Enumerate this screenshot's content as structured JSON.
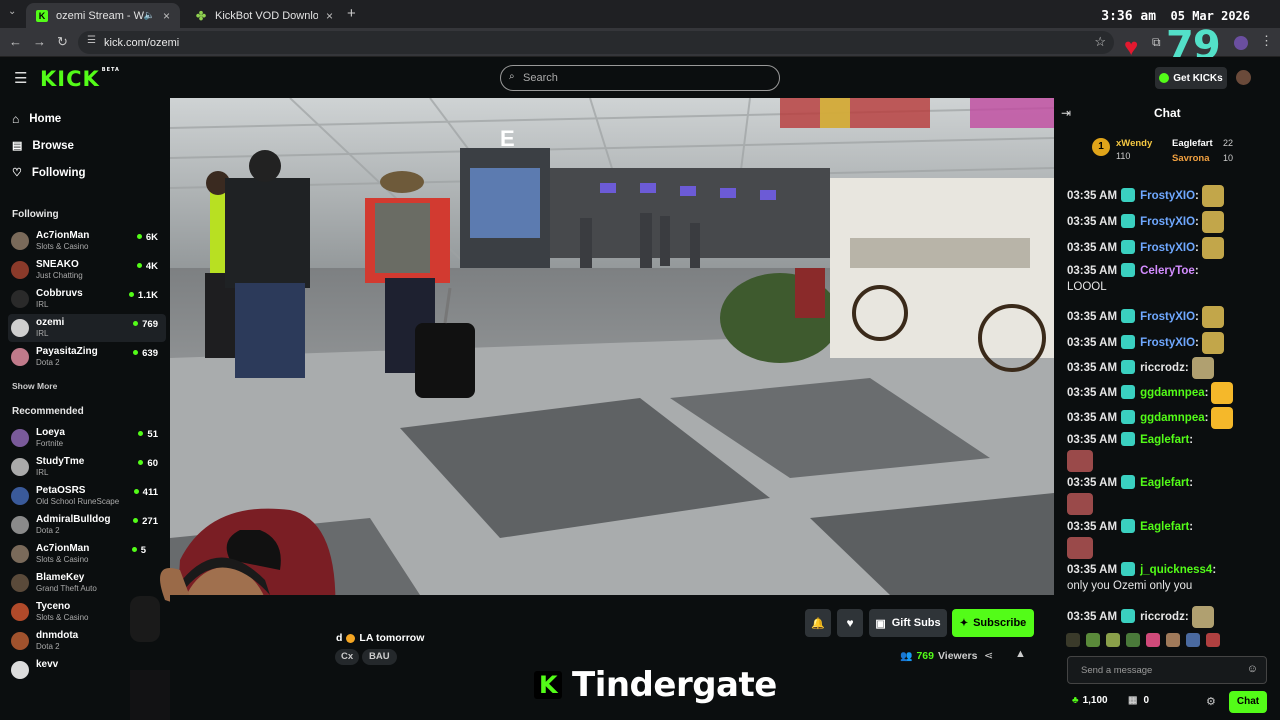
{
  "browser": {
    "tabs": [
      {
        "title": "ozemi Stream - Watch Live",
        "active": true
      },
      {
        "title": "KickBot VOD Downloader",
        "active": false
      }
    ],
    "url": "kick.com/ozemi",
    "clock_time": "3:36 am",
    "clock_date": "05 Mar 2026",
    "overlay_count": "79"
  },
  "header": {
    "logo": "KICK",
    "logo_badge": "BETA",
    "search_placeholder": "Search",
    "get_kicks": "Get KICKs"
  },
  "sidebar": {
    "nav": [
      {
        "label": "Home",
        "icon": "home-icon"
      },
      {
        "label": "Browse",
        "icon": "browse-icon"
      },
      {
        "label": "Following",
        "icon": "heart-icon"
      }
    ],
    "following_title": "Following",
    "following": [
      {
        "name": "Ac7ionMan",
        "category": "Slots & Casino",
        "viewers": "6K"
      },
      {
        "name": "SNEAKO",
        "category": "Just Chatting",
        "viewers": "4K"
      },
      {
        "name": "Cobbruvs",
        "category": "IRL",
        "viewers": "1.1K"
      },
      {
        "name": "ozemi",
        "category": "IRL",
        "viewers": "769"
      },
      {
        "name": "PayasitaZing",
        "category": "Dota 2",
        "viewers": "639"
      }
    ],
    "show_more": "Show More",
    "recommended_title": "Recommended",
    "recommended": [
      {
        "name": "Loeya",
        "category": "Fortnite",
        "viewers": "51"
      },
      {
        "name": "StudyTme",
        "category": "IRL",
        "viewers": "60"
      },
      {
        "name": "PetaOSRS",
        "category": "Old School RuneScape",
        "viewers": "411"
      },
      {
        "name": "AdmiralBulldog",
        "category": "Dota 2",
        "viewers": "271"
      },
      {
        "name": "Ac7ionMan",
        "category": "Slots & Casino",
        "viewers": "5"
      },
      {
        "name": "BlameKey",
        "category": "Grand Theft Auto",
        "viewers": ""
      },
      {
        "name": "Tyceno",
        "category": "Slots & Casino",
        "viewers": ""
      },
      {
        "name": "dnmdota",
        "category": "Dota 2",
        "viewers": ""
      },
      {
        "name": "kevv",
        "category": "",
        "viewers": ""
      }
    ]
  },
  "stream": {
    "title_fragment": "LA tomorrow",
    "title_prefix": "d",
    "tags": [
      "Cx",
      "BAU"
    ],
    "gift_subs": "Gift Subs",
    "subscribe": "Subscribe",
    "viewers": "769",
    "viewers_label": "Viewers",
    "overlay_text": "Tindergate"
  },
  "chat": {
    "title": "Chat",
    "leaderboard": [
      {
        "rank": "1",
        "name": "xWendy",
        "value": "110"
      },
      {
        "name": "Eaglefart",
        "value": "22"
      },
      {
        "name": "Savrona",
        "value": "10"
      }
    ],
    "messages": [
      {
        "time": "03:35 AM",
        "user": "FrostyXIO",
        "color": "#6fa8ff",
        "text": ""
      },
      {
        "time": "03:35 AM",
        "user": "FrostyXIO",
        "color": "#6fa8ff",
        "text": ""
      },
      {
        "time": "03:35 AM",
        "user": "FrostyXIO",
        "color": "#6fa8ff",
        "text": ""
      },
      {
        "time": "03:35 AM",
        "user": "CeleryToe",
        "color": "#d38cff",
        "text": "LOOOL"
      },
      {
        "time": "03:35 AM",
        "user": "FrostyXIO",
        "color": "#6fa8ff",
        "text": ""
      },
      {
        "time": "03:35 AM",
        "user": "FrostyXIO",
        "color": "#6fa8ff",
        "text": ""
      },
      {
        "time": "03:35 AM",
        "user": "riccrodz",
        "color": "#e6e6e6",
        "text": ""
      },
      {
        "time": "03:35 AM",
        "user": "ggdamnpea",
        "color": "#53fc18",
        "text": ""
      },
      {
        "time": "03:35 AM",
        "user": "ggdamnpea",
        "color": "#53fc18",
        "text": ""
      },
      {
        "time": "03:35 AM",
        "user": "Eaglefart",
        "color": "#53fc18",
        "text": ""
      },
      {
        "time": "03:35 AM",
        "user": "Eaglefart",
        "color": "#53fc18",
        "text": ""
      },
      {
        "time": "03:35 AM",
        "user": "Eaglefart",
        "color": "#53fc18",
        "text": ""
      },
      {
        "time": "03:35 AM",
        "user": "j_quickness4",
        "color": "#53fc18",
        "text": "only you Ozemi only you"
      },
      {
        "time": "03:35 AM",
        "user": "riccrodz",
        "color": "#e6e6e6",
        "text": ""
      }
    ],
    "input_placeholder": "Send a message",
    "points": "1,100",
    "gifts": "0",
    "send": "Chat"
  },
  "colors": {
    "brand": "#53fc18",
    "bg": "#0b0e0f"
  }
}
